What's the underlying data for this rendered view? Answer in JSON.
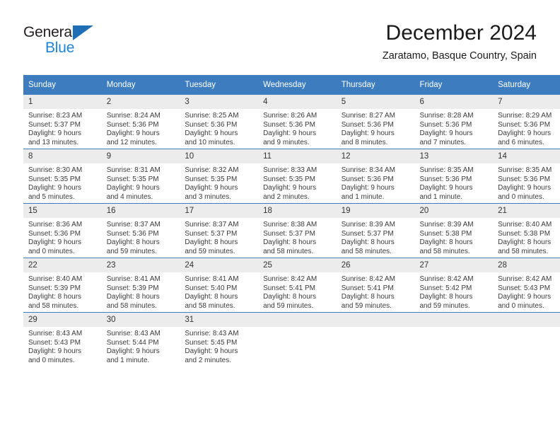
{
  "logo": {
    "primary_text": "General",
    "secondary_text": "Blue",
    "triangle_color": "#1f6eb5",
    "secondary_color": "#1f84d6"
  },
  "header": {
    "title": "December 2024",
    "subtitle": "Zaratamo, Basque Country, Spain"
  },
  "theme": {
    "header_row_bg": "#3d7dbf",
    "daynum_bg": "#ececec",
    "grid_line": "#3d7dbf"
  },
  "weekdays": [
    "Sunday",
    "Monday",
    "Tuesday",
    "Wednesday",
    "Thursday",
    "Friday",
    "Saturday"
  ],
  "weeks": [
    [
      {
        "day": "1",
        "sunrise": "Sunrise: 8:23 AM",
        "sunset": "Sunset: 5:37 PM",
        "daylight1": "Daylight: 9 hours",
        "daylight2": "and 13 minutes."
      },
      {
        "day": "2",
        "sunrise": "Sunrise: 8:24 AM",
        "sunset": "Sunset: 5:36 PM",
        "daylight1": "Daylight: 9 hours",
        "daylight2": "and 12 minutes."
      },
      {
        "day": "3",
        "sunrise": "Sunrise: 8:25 AM",
        "sunset": "Sunset: 5:36 PM",
        "daylight1": "Daylight: 9 hours",
        "daylight2": "and 10 minutes."
      },
      {
        "day": "4",
        "sunrise": "Sunrise: 8:26 AM",
        "sunset": "Sunset: 5:36 PM",
        "daylight1": "Daylight: 9 hours",
        "daylight2": "and 9 minutes."
      },
      {
        "day": "5",
        "sunrise": "Sunrise: 8:27 AM",
        "sunset": "Sunset: 5:36 PM",
        "daylight1": "Daylight: 9 hours",
        "daylight2": "and 8 minutes."
      },
      {
        "day": "6",
        "sunrise": "Sunrise: 8:28 AM",
        "sunset": "Sunset: 5:36 PM",
        "daylight1": "Daylight: 9 hours",
        "daylight2": "and 7 minutes."
      },
      {
        "day": "7",
        "sunrise": "Sunrise: 8:29 AM",
        "sunset": "Sunset: 5:36 PM",
        "daylight1": "Daylight: 9 hours",
        "daylight2": "and 6 minutes."
      }
    ],
    [
      {
        "day": "8",
        "sunrise": "Sunrise: 8:30 AM",
        "sunset": "Sunset: 5:35 PM",
        "daylight1": "Daylight: 9 hours",
        "daylight2": "and 5 minutes."
      },
      {
        "day": "9",
        "sunrise": "Sunrise: 8:31 AM",
        "sunset": "Sunset: 5:35 PM",
        "daylight1": "Daylight: 9 hours",
        "daylight2": "and 4 minutes."
      },
      {
        "day": "10",
        "sunrise": "Sunrise: 8:32 AM",
        "sunset": "Sunset: 5:35 PM",
        "daylight1": "Daylight: 9 hours",
        "daylight2": "and 3 minutes."
      },
      {
        "day": "11",
        "sunrise": "Sunrise: 8:33 AM",
        "sunset": "Sunset: 5:35 PM",
        "daylight1": "Daylight: 9 hours",
        "daylight2": "and 2 minutes."
      },
      {
        "day": "12",
        "sunrise": "Sunrise: 8:34 AM",
        "sunset": "Sunset: 5:36 PM",
        "daylight1": "Daylight: 9 hours",
        "daylight2": "and 1 minute."
      },
      {
        "day": "13",
        "sunrise": "Sunrise: 8:35 AM",
        "sunset": "Sunset: 5:36 PM",
        "daylight1": "Daylight: 9 hours",
        "daylight2": "and 1 minute."
      },
      {
        "day": "14",
        "sunrise": "Sunrise: 8:35 AM",
        "sunset": "Sunset: 5:36 PM",
        "daylight1": "Daylight: 9 hours",
        "daylight2": "and 0 minutes."
      }
    ],
    [
      {
        "day": "15",
        "sunrise": "Sunrise: 8:36 AM",
        "sunset": "Sunset: 5:36 PM",
        "daylight1": "Daylight: 9 hours",
        "daylight2": "and 0 minutes."
      },
      {
        "day": "16",
        "sunrise": "Sunrise: 8:37 AM",
        "sunset": "Sunset: 5:36 PM",
        "daylight1": "Daylight: 8 hours",
        "daylight2": "and 59 minutes."
      },
      {
        "day": "17",
        "sunrise": "Sunrise: 8:37 AM",
        "sunset": "Sunset: 5:37 PM",
        "daylight1": "Daylight: 8 hours",
        "daylight2": "and 59 minutes."
      },
      {
        "day": "18",
        "sunrise": "Sunrise: 8:38 AM",
        "sunset": "Sunset: 5:37 PM",
        "daylight1": "Daylight: 8 hours",
        "daylight2": "and 58 minutes."
      },
      {
        "day": "19",
        "sunrise": "Sunrise: 8:39 AM",
        "sunset": "Sunset: 5:37 PM",
        "daylight1": "Daylight: 8 hours",
        "daylight2": "and 58 minutes."
      },
      {
        "day": "20",
        "sunrise": "Sunrise: 8:39 AM",
        "sunset": "Sunset: 5:38 PM",
        "daylight1": "Daylight: 8 hours",
        "daylight2": "and 58 minutes."
      },
      {
        "day": "21",
        "sunrise": "Sunrise: 8:40 AM",
        "sunset": "Sunset: 5:38 PM",
        "daylight1": "Daylight: 8 hours",
        "daylight2": "and 58 minutes."
      }
    ],
    [
      {
        "day": "22",
        "sunrise": "Sunrise: 8:40 AM",
        "sunset": "Sunset: 5:39 PM",
        "daylight1": "Daylight: 8 hours",
        "daylight2": "and 58 minutes."
      },
      {
        "day": "23",
        "sunrise": "Sunrise: 8:41 AM",
        "sunset": "Sunset: 5:39 PM",
        "daylight1": "Daylight: 8 hours",
        "daylight2": "and 58 minutes."
      },
      {
        "day": "24",
        "sunrise": "Sunrise: 8:41 AM",
        "sunset": "Sunset: 5:40 PM",
        "daylight1": "Daylight: 8 hours",
        "daylight2": "and 58 minutes."
      },
      {
        "day": "25",
        "sunrise": "Sunrise: 8:42 AM",
        "sunset": "Sunset: 5:41 PM",
        "daylight1": "Daylight: 8 hours",
        "daylight2": "and 59 minutes."
      },
      {
        "day": "26",
        "sunrise": "Sunrise: 8:42 AM",
        "sunset": "Sunset: 5:41 PM",
        "daylight1": "Daylight: 8 hours",
        "daylight2": "and 59 minutes."
      },
      {
        "day": "27",
        "sunrise": "Sunrise: 8:42 AM",
        "sunset": "Sunset: 5:42 PM",
        "daylight1": "Daylight: 8 hours",
        "daylight2": "and 59 minutes."
      },
      {
        "day": "28",
        "sunrise": "Sunrise: 8:42 AM",
        "sunset": "Sunset: 5:43 PM",
        "daylight1": "Daylight: 9 hours",
        "daylight2": "and 0 minutes."
      }
    ],
    [
      {
        "day": "29",
        "sunrise": "Sunrise: 8:43 AM",
        "sunset": "Sunset: 5:43 PM",
        "daylight1": "Daylight: 9 hours",
        "daylight2": "and 0 minutes."
      },
      {
        "day": "30",
        "sunrise": "Sunrise: 8:43 AM",
        "sunset": "Sunset: 5:44 PM",
        "daylight1": "Daylight: 9 hours",
        "daylight2": "and 1 minute."
      },
      {
        "day": "31",
        "sunrise": "Sunrise: 8:43 AM",
        "sunset": "Sunset: 5:45 PM",
        "daylight1": "Daylight: 9 hours",
        "daylight2": "and 2 minutes."
      },
      {
        "day": "",
        "sunrise": "",
        "sunset": "",
        "daylight1": "",
        "daylight2": ""
      },
      {
        "day": "",
        "sunrise": "",
        "sunset": "",
        "daylight1": "",
        "daylight2": ""
      },
      {
        "day": "",
        "sunrise": "",
        "sunset": "",
        "daylight1": "",
        "daylight2": ""
      },
      {
        "day": "",
        "sunrise": "",
        "sunset": "",
        "daylight1": "",
        "daylight2": ""
      }
    ]
  ]
}
